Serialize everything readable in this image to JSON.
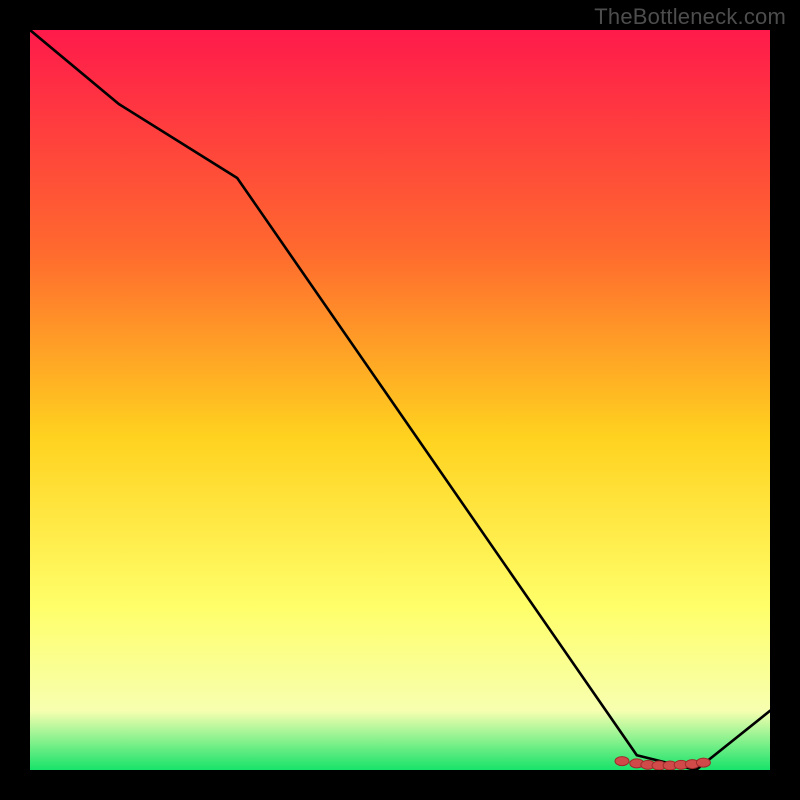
{
  "watermark": "TheBottleneck.com",
  "colors": {
    "page_bg": "#000000",
    "watermark": "#4d4d4d",
    "line": "#000000",
    "marker_fill": "#d14a4a",
    "marker_stroke": "#9e2c2c",
    "gradient_top": "#ff1a4b",
    "gradient_mid1": "#ff6a2e",
    "gradient_mid2": "#ffd21f",
    "gradient_mid3": "#ffff6a",
    "gradient_mid4": "#f7ffb0",
    "gradient_bottom": "#17e36a"
  },
  "chart_data": {
    "type": "line",
    "title": "",
    "xlabel": "",
    "ylabel": "",
    "xlim": [
      0,
      100
    ],
    "ylim": [
      0,
      100
    ],
    "grid": false,
    "annotations": [],
    "series": [
      {
        "name": "curve",
        "x": [
          0,
          12,
          28,
          82,
          90,
          100
        ],
        "y": [
          100,
          90,
          80,
          2,
          0,
          8
        ]
      }
    ],
    "markers": {
      "name": "highlight-cluster",
      "x": [
        80,
        82,
        83.5,
        85,
        86.5,
        88,
        89.5,
        91
      ],
      "y": [
        1.2,
        0.9,
        0.7,
        0.6,
        0.6,
        0.7,
        0.8,
        1.0
      ]
    },
    "note": "x/y are percentages of the inner plot area; curve descends from top-left to a minimum near x≈88 then rises; marker cluster sits on the curve valley."
  }
}
